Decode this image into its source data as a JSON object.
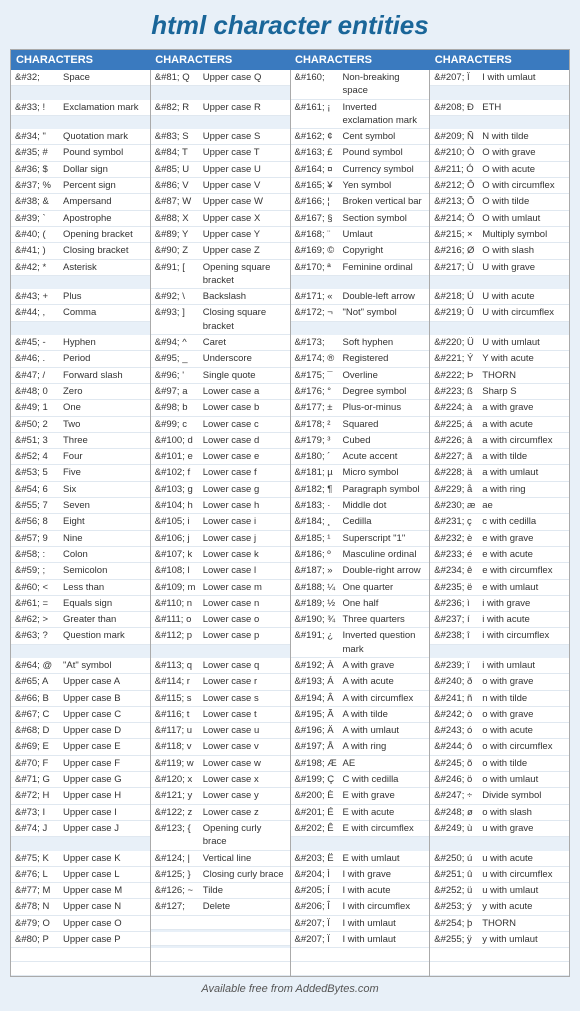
{
  "title": "html character entities",
  "columns": [
    {
      "header": "CHARACTERS",
      "entries": [
        {
          "code": "&#32;",
          "desc": "Space"
        },
        {
          "code": "&#33; !",
          "desc": "Exclamation mark"
        },
        {
          "code": "&#34; \"",
          "desc": "Quotation mark"
        },
        {
          "code": "&#35; #",
          "desc": "Pound symbol"
        },
        {
          "code": "&#36; $",
          "desc": "Dollar sign"
        },
        {
          "code": "&#37; %",
          "desc": "Percent sign"
        },
        {
          "code": "&#38; &",
          "desc": "Ampersand"
        },
        {
          "code": "&#39; `",
          "desc": "Apostrophe"
        },
        {
          "code": "&#40; (",
          "desc": "Opening bracket"
        },
        {
          "code": "&#41; )",
          "desc": "Closing bracket"
        },
        {
          "code": "&#42; *",
          "desc": "Asterisk"
        },
        {
          "code": "&#43; +",
          "desc": "Plus"
        },
        {
          "code": "&#44; ,",
          "desc": "Comma"
        },
        {
          "code": "&#45; -",
          "desc": "Hyphen"
        },
        {
          "code": "&#46; .",
          "desc": "Period"
        },
        {
          "code": "&#47; /",
          "desc": "Forward slash"
        },
        {
          "code": "&#48; 0",
          "desc": "Zero"
        },
        {
          "code": "&#49; 1",
          "desc": "One"
        },
        {
          "code": "&#50; 2",
          "desc": "Two"
        },
        {
          "code": "&#51; 3",
          "desc": "Three"
        },
        {
          "code": "&#52; 4",
          "desc": "Four"
        },
        {
          "code": "&#53; 5",
          "desc": "Five"
        },
        {
          "code": "&#54; 6",
          "desc": "Six"
        },
        {
          "code": "&#55; 7",
          "desc": "Seven"
        },
        {
          "code": "&#56; 8",
          "desc": "Eight"
        },
        {
          "code": "&#57; 9",
          "desc": "Nine"
        },
        {
          "code": "&#58; :",
          "desc": "Colon"
        },
        {
          "code": "&#59; ;",
          "desc": "Semicolon"
        },
        {
          "code": "&#60; <",
          "desc": "Less than"
        },
        {
          "code": "&#61; =",
          "desc": "Equals sign"
        },
        {
          "code": "&#62; >",
          "desc": "Greater than"
        },
        {
          "code": "&#63; ?",
          "desc": "Question mark"
        },
        {
          "code": "&#64; @",
          "desc": "\"At\" symbol"
        },
        {
          "code": "&#65; A",
          "desc": "Upper case A"
        },
        {
          "code": "&#66; B",
          "desc": "Upper case B"
        },
        {
          "code": "&#67; C",
          "desc": "Upper case C"
        },
        {
          "code": "&#68; D",
          "desc": "Upper case D"
        },
        {
          "code": "&#69; E",
          "desc": "Upper case E"
        },
        {
          "code": "&#70; F",
          "desc": "Upper case F"
        },
        {
          "code": "&#71; G",
          "desc": "Upper case G"
        },
        {
          "code": "&#72; H",
          "desc": "Upper case H"
        },
        {
          "code": "&#73; I",
          "desc": "Upper case I"
        },
        {
          "code": "&#74; J",
          "desc": "Upper case J"
        },
        {
          "code": "&#75; K",
          "desc": "Upper case K"
        },
        {
          "code": "&#76; L",
          "desc": "Upper case L"
        },
        {
          "code": "&#77; M",
          "desc": "Upper case M"
        },
        {
          "code": "&#78; N",
          "desc": "Upper case N"
        },
        {
          "code": "&#79; O",
          "desc": "Upper case O"
        },
        {
          "code": "&#80; P",
          "desc": "Upper case P"
        }
      ]
    },
    {
      "header": "CHARACTERS",
      "entries": [
        {
          "code": "&#81; Q",
          "desc": "Upper case Q"
        },
        {
          "code": "&#82; R",
          "desc": "Upper case R"
        },
        {
          "code": "&#83; S",
          "desc": "Upper case S"
        },
        {
          "code": "&#84; T",
          "desc": "Upper case T"
        },
        {
          "code": "&#85; U",
          "desc": "Upper case U"
        },
        {
          "code": "&#86; V",
          "desc": "Upper case V"
        },
        {
          "code": "&#87; W",
          "desc": "Upper case W"
        },
        {
          "code": "&#88; X",
          "desc": "Upper case X"
        },
        {
          "code": "&#89; Y",
          "desc": "Upper case Y"
        },
        {
          "code": "&#90; Z",
          "desc": "Upper case Z"
        },
        {
          "code": "&#91; [",
          "desc": "Opening square bracket"
        },
        {
          "code": "&#92; \\",
          "desc": "Backslash"
        },
        {
          "code": "&#93; ]",
          "desc": "Closing square bracket"
        },
        {
          "code": "&#94; ^",
          "desc": "Caret"
        },
        {
          "code": "&#95; _",
          "desc": "Underscore"
        },
        {
          "code": "&#96; '",
          "desc": "Single quote"
        },
        {
          "code": "&#97; a",
          "desc": "Lower case a"
        },
        {
          "code": "&#98; b",
          "desc": "Lower case b"
        },
        {
          "code": "&#99; c",
          "desc": "Lower case c"
        },
        {
          "code": "&#100; d",
          "desc": "Lower case d"
        },
        {
          "code": "&#101; e",
          "desc": "Lower case e"
        },
        {
          "code": "&#102; f",
          "desc": "Lower case f"
        },
        {
          "code": "&#103; g",
          "desc": "Lower case g"
        },
        {
          "code": "&#104; h",
          "desc": "Lower case h"
        },
        {
          "code": "&#105; i",
          "desc": "Lower case i"
        },
        {
          "code": "&#106; j",
          "desc": "Lower case j"
        },
        {
          "code": "&#107; k",
          "desc": "Lower case k"
        },
        {
          "code": "&#108; l",
          "desc": "Lower case l"
        },
        {
          "code": "&#109; m",
          "desc": "Lower case m"
        },
        {
          "code": "&#110; n",
          "desc": "Lower case n"
        },
        {
          "code": "&#111; o",
          "desc": "Lower case o"
        },
        {
          "code": "&#112; p",
          "desc": "Lower case p"
        },
        {
          "code": "&#113; q",
          "desc": "Lower case q"
        },
        {
          "code": "&#114; r",
          "desc": "Lower case r"
        },
        {
          "code": "&#115; s",
          "desc": "Lower case s"
        },
        {
          "code": "&#116; t",
          "desc": "Lower case t"
        },
        {
          "code": "&#117; u",
          "desc": "Lower case u"
        },
        {
          "code": "&#118; v",
          "desc": "Lower case v"
        },
        {
          "code": "&#119; w",
          "desc": "Lower case w"
        },
        {
          "code": "&#120; x",
          "desc": "Lower case x"
        },
        {
          "code": "&#121; y",
          "desc": "Lower case y"
        },
        {
          "code": "&#122; z",
          "desc": "Lower case z"
        },
        {
          "code": "&#123; {",
          "desc": "Opening curly brace"
        },
        {
          "code": "&#124; |",
          "desc": "Vertical line"
        },
        {
          "code": "&#125; }",
          "desc": "Closing curly brace"
        },
        {
          "code": "&#126; ~",
          "desc": "Tilde"
        },
        {
          "code": "&#127;",
          "desc": "Delete"
        },
        {
          "code": "",
          "desc": ""
        },
        {
          "code": "",
          "desc": ""
        },
        {
          "code": "",
          "desc": ""
        }
      ]
    },
    {
      "header": "CHARACTERS",
      "entries": [
        {
          "code": "&#160;",
          "desc": "Non-breaking space"
        },
        {
          "code": "&#161; ¡",
          "desc": "Inverted exclamation mark"
        },
        {
          "code": "&#162; ¢",
          "desc": "Cent symbol"
        },
        {
          "code": "&#163; £",
          "desc": "Pound symbol"
        },
        {
          "code": "&#164; ¤",
          "desc": "Currency symbol"
        },
        {
          "code": "&#165; ¥",
          "desc": "Yen symbol"
        },
        {
          "code": "&#166; ¦",
          "desc": "Broken vertical bar"
        },
        {
          "code": "&#167; §",
          "desc": "Section symbol"
        },
        {
          "code": "&#168; ¨",
          "desc": "Umlaut"
        },
        {
          "code": "&#169; ©",
          "desc": "Copyright"
        },
        {
          "code": "&#170; ª",
          "desc": "Feminine ordinal"
        },
        {
          "code": "&#171; «",
          "desc": "Double-left arrow"
        },
        {
          "code": "&#172; ¬",
          "desc": "\"Not\" symbol"
        },
        {
          "code": "&#173;",
          "desc": "Soft hyphen"
        },
        {
          "code": "&#174; ®",
          "desc": "Registered"
        },
        {
          "code": "&#175; ¯",
          "desc": "Overline"
        },
        {
          "code": "&#176; °",
          "desc": "Degree symbol"
        },
        {
          "code": "&#177; ±",
          "desc": "Plus-or-minus"
        },
        {
          "code": "&#178; ²",
          "desc": "Squared"
        },
        {
          "code": "&#179; ³",
          "desc": "Cubed"
        },
        {
          "code": "&#180; ´",
          "desc": "Acute accent"
        },
        {
          "code": "&#181; µ",
          "desc": "Micro symbol"
        },
        {
          "code": "&#182; ¶",
          "desc": "Paragraph symbol"
        },
        {
          "code": "&#183; ·",
          "desc": "Middle dot"
        },
        {
          "code": "&#184; ¸",
          "desc": "Cedilla"
        },
        {
          "code": "&#185; ¹",
          "desc": "Superscript \"1\""
        },
        {
          "code": "&#186; º",
          "desc": "Masculine ordinal"
        },
        {
          "code": "&#187; »",
          "desc": "Double-right arrow"
        },
        {
          "code": "&#188; ¼",
          "desc": "One quarter"
        },
        {
          "code": "&#189; ½",
          "desc": "One half"
        },
        {
          "code": "&#190; ¾",
          "desc": "Three quarters"
        },
        {
          "code": "&#191; ¿",
          "desc": "Inverted question mark"
        },
        {
          "code": "&#192; À",
          "desc": "A with grave"
        },
        {
          "code": "&#193; Á",
          "desc": "A with acute"
        },
        {
          "code": "&#194; Â",
          "desc": "A with circumflex"
        },
        {
          "code": "&#195; Ã",
          "desc": "A with tilde"
        },
        {
          "code": "&#196; Ä",
          "desc": "A with umlaut"
        },
        {
          "code": "&#197; Å",
          "desc": "A with ring"
        },
        {
          "code": "&#198; Æ",
          "desc": "AE"
        },
        {
          "code": "&#199; Ç",
          "desc": "C with cedilla"
        },
        {
          "code": "&#200; È",
          "desc": "E with grave"
        },
        {
          "code": "&#201; É",
          "desc": "E with acute"
        },
        {
          "code": "&#202; Ê",
          "desc": "E with circumflex"
        },
        {
          "code": "&#203; Ë",
          "desc": "E with umlaut"
        },
        {
          "code": "&#204; Ì",
          "desc": "I with grave"
        },
        {
          "code": "&#205; Í",
          "desc": "I with acute"
        },
        {
          "code": "&#206; Î",
          "desc": "I with circumflex"
        },
        {
          "code": "&#207; Ï",
          "desc": "I with umlaut"
        },
        {
          "code": "&#207; Ï",
          "desc": "I with umlaut"
        },
        {
          "code": "",
          "desc": ""
        },
        {
          "code": "",
          "desc": ""
        }
      ]
    },
    {
      "header": "CHARACTERS",
      "entries": [
        {
          "code": "&#207; Ï",
          "desc": "I with umlaut"
        },
        {
          "code": "&#208; Ð",
          "desc": "ETH"
        },
        {
          "code": "&#209; Ñ",
          "desc": "N with tilde"
        },
        {
          "code": "&#210; Ò",
          "desc": "O with grave"
        },
        {
          "code": "&#211; Ó",
          "desc": "O with acute"
        },
        {
          "code": "&#212; Ô",
          "desc": "O with circumflex"
        },
        {
          "code": "&#213; Õ",
          "desc": "O with tilde"
        },
        {
          "code": "&#214; Ö",
          "desc": "O with umlaut"
        },
        {
          "code": "&#215; ×",
          "desc": "Multiply symbol"
        },
        {
          "code": "&#216; Ø",
          "desc": "O with slash"
        },
        {
          "code": "&#217; Ù",
          "desc": "U with grave"
        },
        {
          "code": "&#218; Ú",
          "desc": "U with acute"
        },
        {
          "code": "&#219; Û",
          "desc": "U with circumflex"
        },
        {
          "code": "&#220; Ü",
          "desc": "U with umlaut"
        },
        {
          "code": "&#221; Ý",
          "desc": "Y with acute"
        },
        {
          "code": "&#222; Þ",
          "desc": "THORN"
        },
        {
          "code": "&#223; ß",
          "desc": "Sharp S"
        },
        {
          "code": "&#224; à",
          "desc": "a with grave"
        },
        {
          "code": "&#225; á",
          "desc": "a with acute"
        },
        {
          "code": "&#226; â",
          "desc": "a with circumflex"
        },
        {
          "code": "&#227; ã",
          "desc": "a with tilde"
        },
        {
          "code": "&#228; ä",
          "desc": "a with umlaut"
        },
        {
          "code": "&#229; å",
          "desc": "a with ring"
        },
        {
          "code": "&#230; æ",
          "desc": "ae"
        },
        {
          "code": "&#231; ç",
          "desc": "c with cedilla"
        },
        {
          "code": "&#232; è",
          "desc": "e with grave"
        },
        {
          "code": "&#233; é",
          "desc": "e with acute"
        },
        {
          "code": "&#234; ê",
          "desc": "e with circumflex"
        },
        {
          "code": "&#235; ë",
          "desc": "e with umlaut"
        },
        {
          "code": "&#236; ì",
          "desc": "i with grave"
        },
        {
          "code": "&#237; í",
          "desc": "i with acute"
        },
        {
          "code": "&#238; î",
          "desc": "i with circumflex"
        },
        {
          "code": "&#239; ï",
          "desc": "i with umlaut"
        },
        {
          "code": "&#240; ð",
          "desc": "o with grave"
        },
        {
          "code": "&#241; ñ",
          "desc": "n with tilde"
        },
        {
          "code": "&#242; ò",
          "desc": "o with grave"
        },
        {
          "code": "&#243; ó",
          "desc": "o with acute"
        },
        {
          "code": "&#244; ô",
          "desc": "o with circumflex"
        },
        {
          "code": "&#245; õ",
          "desc": "o with tilde"
        },
        {
          "code": "&#246; ö",
          "desc": "o with umlaut"
        },
        {
          "code": "&#247; ÷",
          "desc": "Divide symbol"
        },
        {
          "code": "&#248; ø",
          "desc": "o with slash"
        },
        {
          "code": "&#249; ù",
          "desc": "u with grave"
        },
        {
          "code": "&#250; ú",
          "desc": "u with acute"
        },
        {
          "code": "&#251; û",
          "desc": "u with circumflex"
        },
        {
          "code": "&#252; ü",
          "desc": "u with umlaut"
        },
        {
          "code": "&#253; ý",
          "desc": "y with acute"
        },
        {
          "code": "&#254; þ",
          "desc": "THORN"
        },
        {
          "code": "&#255; ÿ",
          "desc": "y with umlaut"
        },
        {
          "code": "",
          "desc": ""
        }
      ]
    }
  ],
  "footer": "Available free from AddedBytes.com"
}
